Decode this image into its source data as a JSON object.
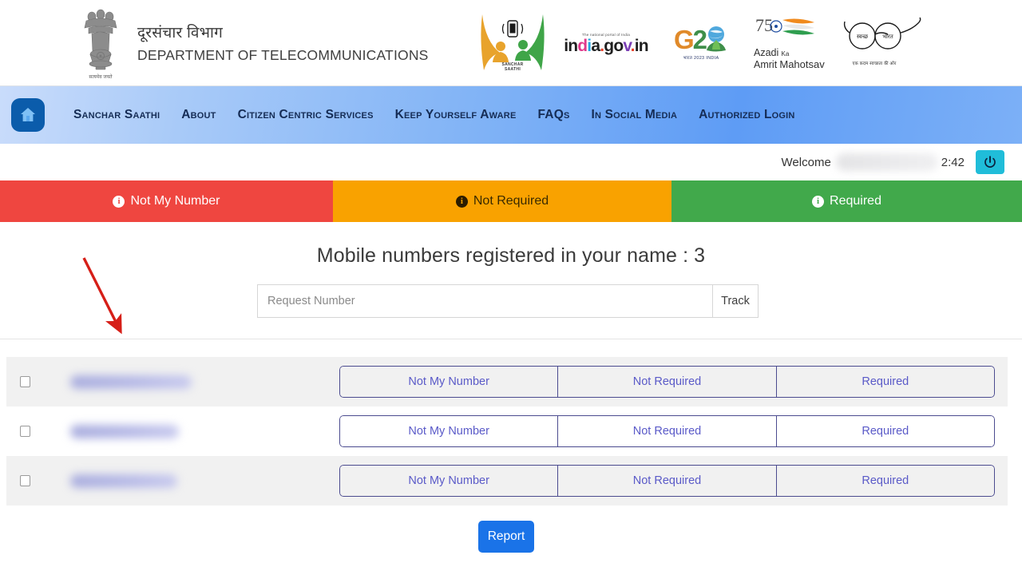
{
  "masthead": {
    "emblem_name": "india-state-emblem",
    "emblem_motto": "सत्यमेव जयते",
    "dept_hi": "दूरसंचार विभाग",
    "dept_en": "DEPARTMENT OF TELECOMMUNICATIONS",
    "logos": [
      {
        "name": "sanchar-saathi-logo",
        "label": "SANCHAR\nSAATHI",
        "line1": "SANCHAR",
        "line2": "SAATHI"
      },
      {
        "name": "india-gov-in-logo",
        "tagline": "The national portal of India",
        "text": "india.gov.in"
      },
      {
        "name": "g20-logo",
        "text": "G20",
        "sub": "भारत 2023 INDIA"
      },
      {
        "name": "azadi-ka-amrit-mahotsav-logo",
        "l1": "Azadi",
        "l2": "Ka",
        "l3": "Amrit",
        "l4": "Mahotsav",
        "num": "75"
      },
      {
        "name": "swachh-bharat-logo",
        "lens_left": "स्वच्छ",
        "lens_right": "भारत",
        "sub": "एक कदम स्वच्छता की ओर"
      }
    ]
  },
  "nav": {
    "home_icon": "home-icon",
    "items": [
      {
        "label": "Sanchar Saathi"
      },
      {
        "label": "About"
      },
      {
        "label": "Citizen Centric Services"
      },
      {
        "label": "Keep Yourself Aware"
      },
      {
        "label": "FAQs"
      },
      {
        "label": "In Social Media"
      },
      {
        "label": "Authorized Login"
      }
    ]
  },
  "welcome": {
    "label": "Welcome",
    "user_name": "",
    "timer": "2:42",
    "power_icon": "power-icon"
  },
  "bands": [
    {
      "label": "Not My Number",
      "color": "#ef4640",
      "text_color": "#ffffff",
      "icon": "info-circle-icon"
    },
    {
      "label": "Not Required",
      "color": "#f9a200",
      "text_color": "#3a2a00",
      "icon": "info-circle-icon"
    },
    {
      "label": "Required",
      "color": "#41a94b",
      "text_color": "#ffffff",
      "icon": "info-circle-icon"
    }
  ],
  "main": {
    "heading": "Mobile numbers registered in your name : 3",
    "registered_count": "3",
    "search": {
      "placeholder": "Request Number",
      "value": "",
      "track_label": "Track"
    },
    "actions": {
      "not_my_number": "Not My Number",
      "not_required": "Not Required",
      "required": "Required"
    },
    "rows": [
      {
        "checkbox_checked": false,
        "number": "",
        "blur_width": "152"
      },
      {
        "checkbox_checked": false,
        "number": "",
        "blur_width": "136"
      },
      {
        "checkbox_checked": false,
        "number": "",
        "blur_width": "134"
      }
    ],
    "report_label": "Report"
  },
  "annotation": {
    "arrow_color": "#d61f18",
    "arrow_name": "red-pointer-arrow"
  },
  "colors": {
    "nav_text": "#152c55",
    "segment_border": "#4b4b8f",
    "segment_text": "#5a5ac8",
    "report_bg": "#1a73e8",
    "power_bg": "#20bdd9"
  }
}
